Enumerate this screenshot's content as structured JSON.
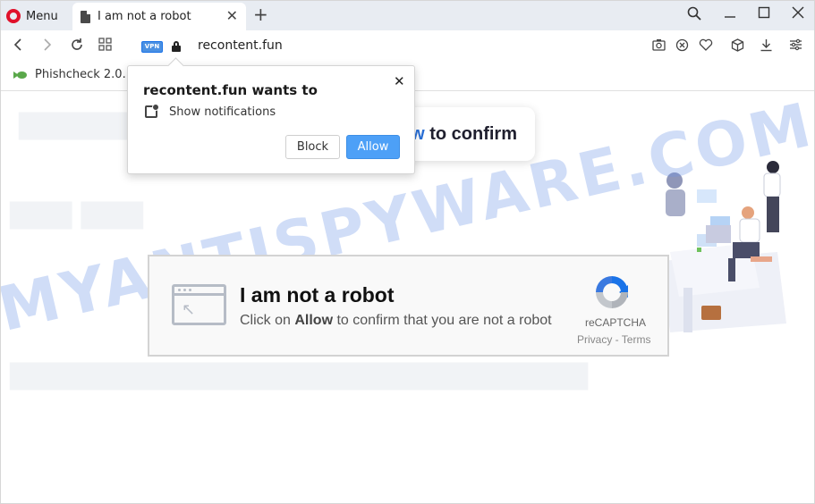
{
  "browser": {
    "menu_label": "Menu",
    "tab_title": "I am not a robot",
    "url": "recontent.fun",
    "vpn_badge": "VPN",
    "accent_color": "#e0112b"
  },
  "bookmarks": {
    "items": [
      {
        "label": "Phishcheck 2.0..."
      }
    ]
  },
  "popup": {
    "title": "recontent.fun wants to",
    "permission": "Show notifications",
    "block_label": "Block",
    "allow_label": "Allow",
    "allow_color": "#4da0f7"
  },
  "page": {
    "confirm_prefix": "w",
    "confirm_suffix": " to confirm",
    "captcha": {
      "title": "I am not a robot",
      "sub_prefix": "Click on ",
      "sub_bold": "Allow",
      "sub_suffix": " to confirm that you are not a robot",
      "brand": "reCAPTCHA",
      "links": "Privacy - Terms"
    },
    "watermark": "MYANTISPYWARE.COM"
  }
}
